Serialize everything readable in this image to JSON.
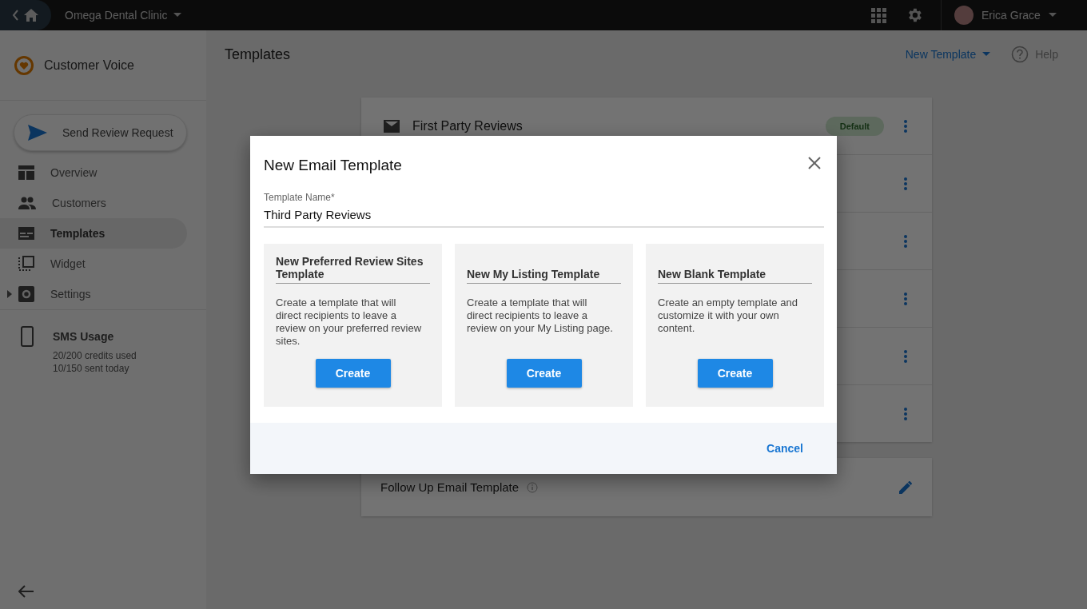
{
  "topbar": {
    "clinic": "Omega Dental Clinic",
    "user": "Erica Grace"
  },
  "sidebar": {
    "app_name": "Customer Voice",
    "send_button": "Send Review Request",
    "nav": [
      {
        "label": "Overview",
        "selected": false,
        "expandable": false
      },
      {
        "label": "Customers",
        "selected": false,
        "expandable": false
      },
      {
        "label": "Templates",
        "selected": true,
        "expandable": false
      },
      {
        "label": "Widget",
        "selected": false,
        "expandable": false
      },
      {
        "label": "Settings",
        "selected": false,
        "expandable": true
      }
    ],
    "sms": {
      "title": "SMS Usage",
      "lines": [
        "20/200 credits used",
        "10/150 sent today"
      ]
    }
  },
  "main": {
    "title": "Templates",
    "new_template": "New Template",
    "help": "Help",
    "template_rows": [
      {
        "kind": "visible",
        "title": "First Party Reviews",
        "badge": "Default"
      },
      {
        "kind": "covered"
      },
      {
        "kind": "covered"
      },
      {
        "kind": "covered"
      },
      {
        "kind": "covered"
      },
      {
        "kind": "covered"
      }
    ],
    "followup": {
      "title": "Follow Up Email Template"
    }
  },
  "dialog": {
    "title": "New Email Template",
    "field": {
      "label": "Template Name*",
      "value": "Third Party Reviews"
    },
    "options": [
      {
        "title": "New Preferred Review Sites Template",
        "description": "Create a template that will direct recipients to leave a review on your preferred review sites.",
        "button": "Create"
      },
      {
        "title": "New My Listing Template",
        "description": "Create a template that will direct recipients to leave a review on your My Listing page.",
        "button": "Create"
      },
      {
        "title": "New Blank Template",
        "description": "Create an empty template and customize it with your own content.",
        "button": "Create"
      }
    ],
    "cancel": "Cancel"
  }
}
